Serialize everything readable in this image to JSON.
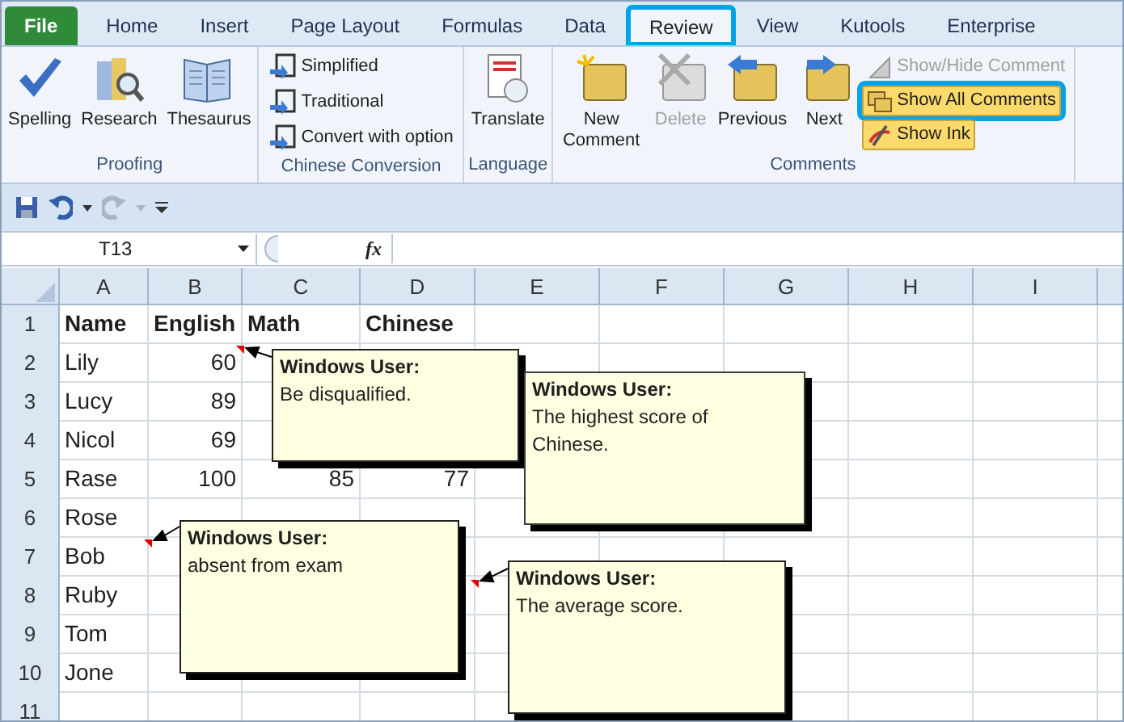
{
  "tabs": [
    {
      "label": "File",
      "kind": "file",
      "selected": false,
      "callout": false
    },
    {
      "label": "Home",
      "kind": "tab",
      "selected": false,
      "callout": false
    },
    {
      "label": "Insert",
      "kind": "tab",
      "selected": false,
      "callout": false
    },
    {
      "label": "Page Layout",
      "kind": "tab",
      "selected": false,
      "callout": false
    },
    {
      "label": "Formulas",
      "kind": "tab",
      "selected": false,
      "callout": false
    },
    {
      "label": "Data",
      "kind": "tab",
      "selected": false,
      "callout": false
    },
    {
      "label": "Review",
      "kind": "tab",
      "selected": true,
      "callout": true
    },
    {
      "label": "View",
      "kind": "tab",
      "selected": false,
      "callout": false
    },
    {
      "label": "Kutools",
      "kind": "tab",
      "selected": false,
      "callout": false
    },
    {
      "label": "Enterprise",
      "kind": "tab",
      "selected": false,
      "callout": false
    }
  ],
  "ribbon": {
    "groups": [
      {
        "label": "Proofing",
        "kind": "large",
        "buttons": [
          {
            "label": "Spelling"
          },
          {
            "label": "Research"
          },
          {
            "label": "Thesaurus"
          }
        ]
      },
      {
        "label": "Chinese Conversion",
        "kind": "small",
        "buttons": [
          {
            "label": "Simplified"
          },
          {
            "label": "Traditional"
          },
          {
            "label": "Convert with option"
          }
        ]
      },
      {
        "label": "Language",
        "kind": "large",
        "buttons": [
          {
            "label": "Translate"
          }
        ]
      },
      {
        "label": "Comments",
        "kind": "comments",
        "buttons": [
          {
            "label": "New Comment",
            "disabled": false
          },
          {
            "label": "Delete",
            "disabled": true
          },
          {
            "label": "Previous",
            "disabled": false
          },
          {
            "label": "Next",
            "disabled": false
          }
        ],
        "toggles": [
          {
            "label": "Show/Hide Comment",
            "disabled": true,
            "on": false,
            "callout": false
          },
          {
            "label": "Show All Comments",
            "disabled": false,
            "on": true,
            "callout": true
          },
          {
            "label": "Show Ink",
            "disabled": false,
            "on": true,
            "callout": false
          }
        ]
      }
    ]
  },
  "formula_bar": {
    "name_box": "T13",
    "fx": "fx"
  },
  "sheet": {
    "columns": [
      "A",
      "B",
      "C",
      "D",
      "E",
      "F",
      "G",
      "H",
      "I"
    ],
    "rows": [
      {
        "number": "1",
        "kind": "header",
        "cells": [
          "Name",
          "English",
          "Math",
          "Chinese"
        ]
      },
      {
        "number": "2",
        "kind": "data",
        "cells": [
          "Lily",
          "60"
        ]
      },
      {
        "number": "3",
        "kind": "data",
        "cells": [
          "Lucy",
          "89"
        ]
      },
      {
        "number": "4",
        "kind": "data",
        "cells": [
          "Nicol",
          "69"
        ]
      },
      {
        "number": "5",
        "kind": "data",
        "cells": [
          "Rase",
          "100",
          "85",
          "77"
        ]
      },
      {
        "number": "6",
        "kind": "data",
        "cells": [
          "Rose"
        ]
      },
      {
        "number": "7",
        "kind": "data",
        "cells": [
          "Bob"
        ]
      },
      {
        "number": "8",
        "kind": "data",
        "cells": [
          "Ruby"
        ]
      },
      {
        "number": "9",
        "kind": "data",
        "cells": [
          "Tom"
        ]
      },
      {
        "number": "10",
        "kind": "data",
        "cells": [
          "Jone"
        ]
      },
      {
        "number": "11",
        "kind": "data",
        "cells": []
      }
    ]
  },
  "comments": [
    {
      "author": "Windows User:",
      "text": "Be disqualified.",
      "arrow": true
    },
    {
      "author": "Windows User:",
      "text": "The highest score of Chinese.",
      "arrow": false
    },
    {
      "author": "Windows User:",
      "text": "absent from exam",
      "arrow": true
    },
    {
      "author": "Windows User:",
      "text": "The average score.",
      "arrow": true
    }
  ]
}
